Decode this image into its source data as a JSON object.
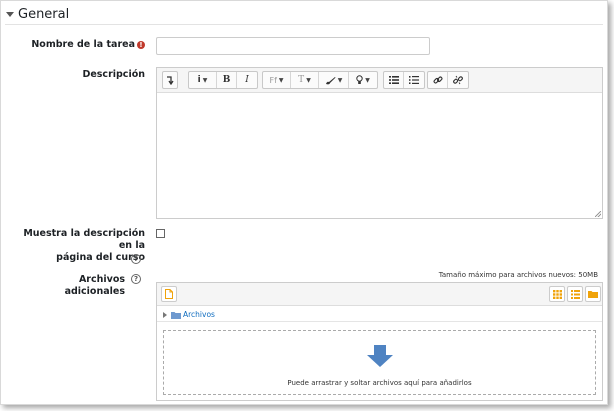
{
  "section": {
    "title": "General"
  },
  "fields": {
    "task_name": {
      "label": "Nombre de la tarea",
      "required_symbol": "!",
      "value": ""
    },
    "description": {
      "label": "Descripción"
    },
    "show_description": {
      "label_line1": "Muestra la descripción en la",
      "label_line2": "página del curso",
      "checked": false
    },
    "additional_files": {
      "label": "Archivos adicionales",
      "max_size": "Tamaño máximo para archivos nuevos: 50MB"
    }
  },
  "editor_toolbar": {
    "undo_icon": "undo-arrow-icon",
    "info_label": "i",
    "bold_label": "B",
    "italic_label": "I",
    "font_label": "Ff",
    "size_label": "T",
    "color_icon": "brush-icon",
    "highlight_icon": "bulb-icon",
    "bullet_list_icon": "unordered-list-icon",
    "numbered_list_icon": "ordered-list-icon",
    "link_icon": "link-icon",
    "unlink_icon": "unlink-icon"
  },
  "file_manager": {
    "add_file_icon": "file-add-icon",
    "view_icons": [
      "grid-view-icon",
      "list-view-icon",
      "folder-view-icon"
    ],
    "path_folder": "Archivos",
    "drop_text": "Puede arrastrar y soltar archivos aquí para añadirlos"
  },
  "help_symbol": "?",
  "colors": {
    "link": "#0f6cbf",
    "required": "#c0392b",
    "toolbar_icon_orange": "#f0a30a",
    "drop_arrow": "#4f83c2"
  }
}
